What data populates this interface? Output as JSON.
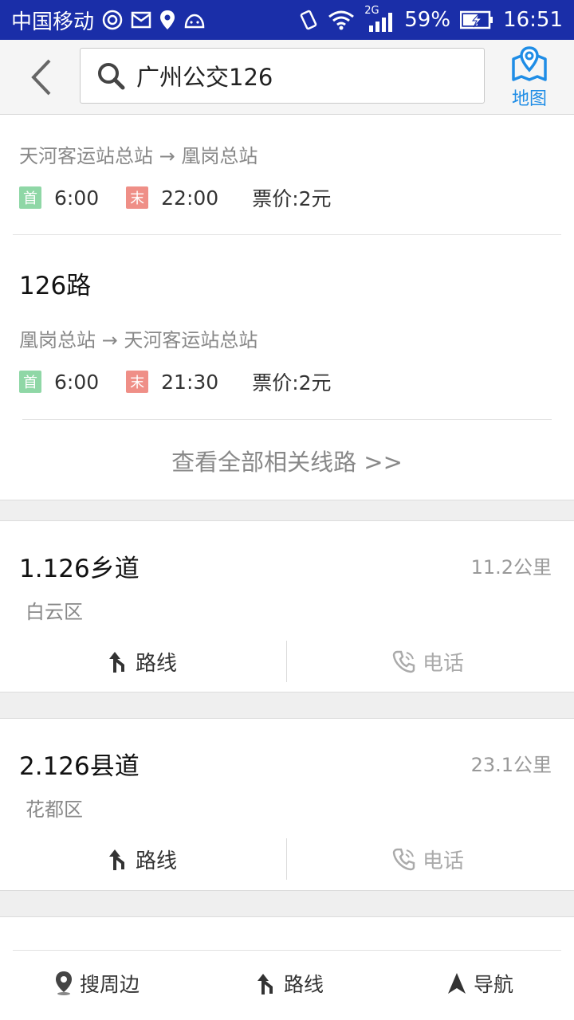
{
  "status_bar": {
    "carrier": "中国移动",
    "network": "2G",
    "battery": "59%",
    "time": "16:51"
  },
  "search": {
    "query": "广州公交126",
    "map_label": "地图"
  },
  "routes": [
    {
      "name": "",
      "stops": "天河客运站总站 → 凰岗总站",
      "first_tag": "首",
      "first_time": "6:00",
      "last_tag": "末",
      "last_time": "22:00",
      "price": "票价:2元"
    },
    {
      "name": "126路",
      "stops": "凰岗总站 → 天河客运站总站",
      "first_tag": "首",
      "first_time": "6:00",
      "last_tag": "末",
      "last_time": "21:30",
      "price": "票价:2元"
    }
  ],
  "view_all": "查看全部相关线路 >>",
  "results": [
    {
      "title": "1.126乡道",
      "distance": "11.2公里",
      "district": "白云区",
      "route_label": "路线",
      "phone_label": "电话"
    },
    {
      "title": "2.126县道",
      "distance": "23.1公里",
      "district": "花都区",
      "route_label": "路线",
      "phone_label": "电话"
    }
  ],
  "bottom_bar": {
    "nearby": "搜周边",
    "route": "路线",
    "navigate": "导航"
  },
  "colors": {
    "status_bar": "#1a2ea8",
    "accent": "#1f8de6",
    "first_tag": "#8fd7a6",
    "last_tag": "#ef8f87"
  }
}
